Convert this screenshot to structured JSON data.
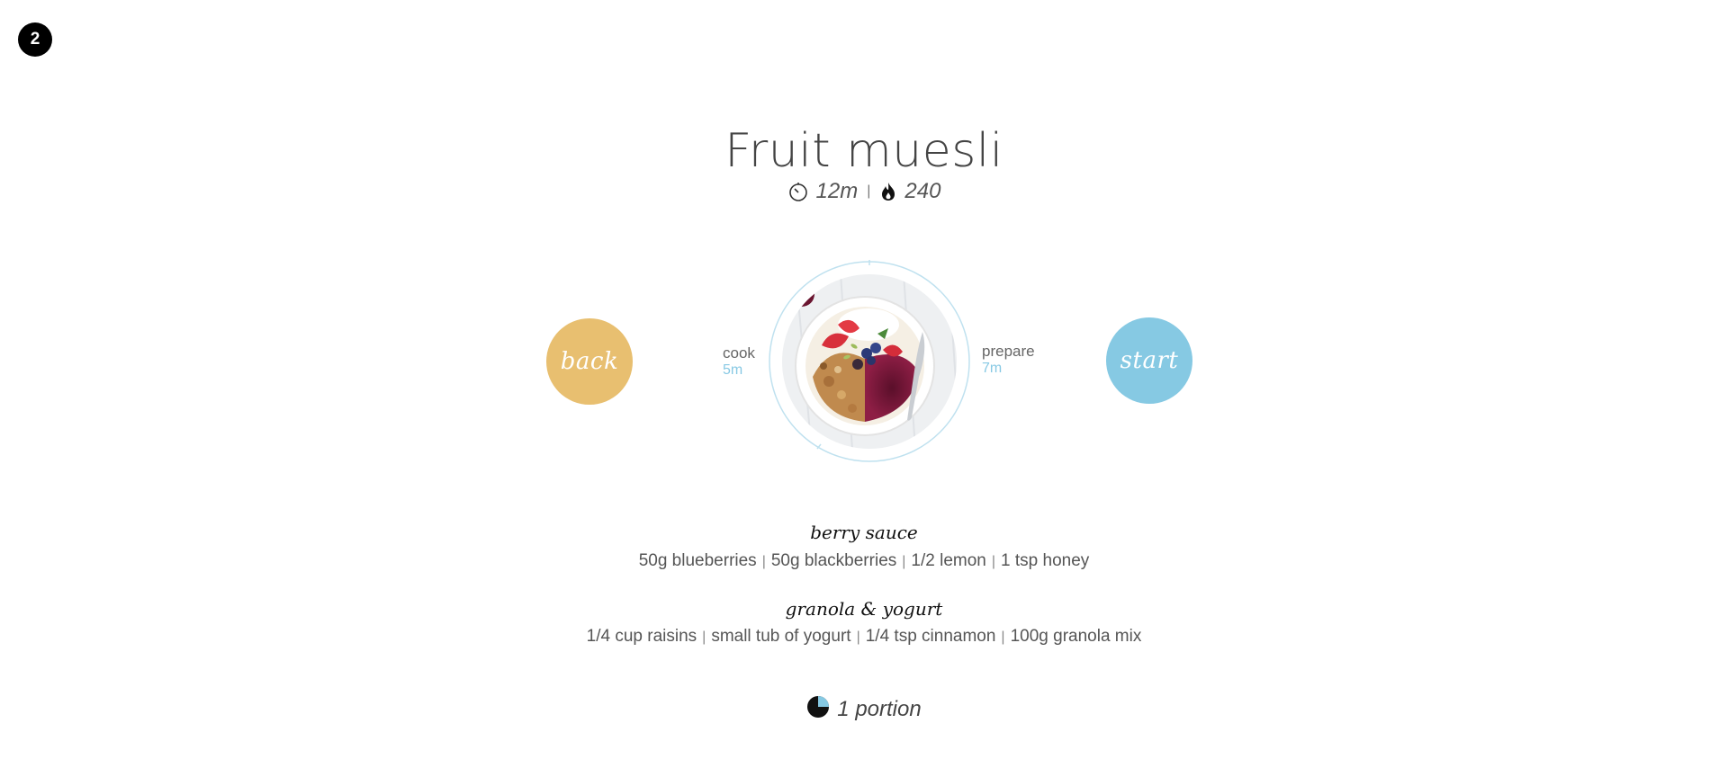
{
  "step": {
    "number": "2"
  },
  "recipe": {
    "title": "Fruit muesli",
    "total_time": "12m",
    "calories": "240"
  },
  "icons": {
    "timer": "timer-icon",
    "flame": "flame-icon",
    "portion": "pie-portion-icon"
  },
  "buttons": {
    "back_label": "back",
    "start_label": "start"
  },
  "times": {
    "cook_label": "cook",
    "cook_value": "5m",
    "prepare_label": "prepare",
    "prepare_value": "7m"
  },
  "sections": [
    {
      "title": "berry sauce",
      "items": [
        "50g blueberries",
        "50g blackberries",
        "1/2 lemon",
        "1 tsp honey"
      ]
    },
    {
      "title": "granola & yogurt",
      "items": [
        "1/4 cup raisins",
        "small tub of yogurt",
        "1/4 tsp cinnamon",
        "100g granola mix"
      ]
    }
  ],
  "portion": {
    "label": "1 portion"
  },
  "colors": {
    "back": "#e8bf70",
    "start": "#86c9e3",
    "accent_time": "#88c9e4",
    "badge": "#000000"
  }
}
